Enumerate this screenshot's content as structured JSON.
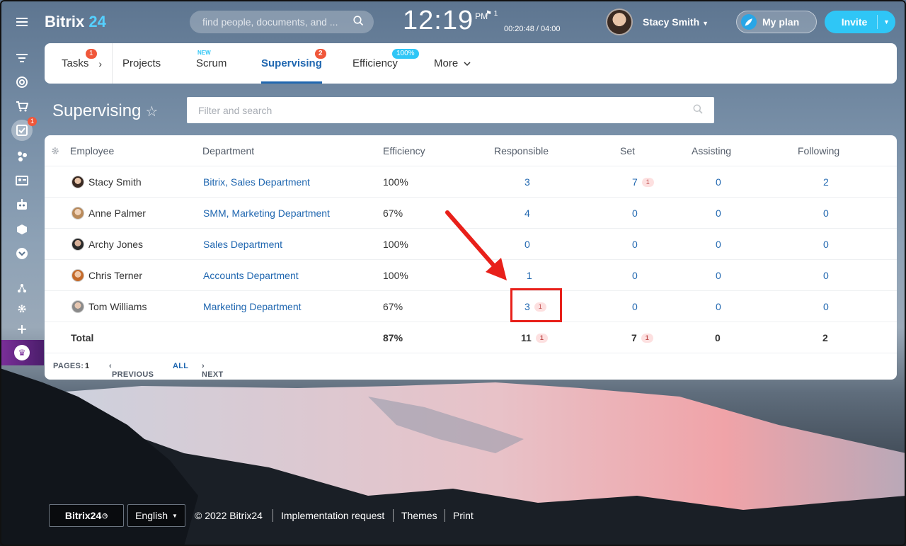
{
  "app": {
    "logo_name": "Bitrix",
    "logo_num": "24",
    "search_placeholder": "find people, documents, and ...",
    "clock_time": "12:19",
    "clock_ampm": "PM",
    "flag_count": "1",
    "timer": "00:20:48 / 04:00",
    "user_name": "Stacy Smith",
    "myplan_label": "My plan",
    "invite_label": "Invite"
  },
  "sidebar": {
    "active_badge": "1"
  },
  "tabs": [
    {
      "label": "Tasks",
      "badge": "1"
    },
    {
      "label": "Projects"
    },
    {
      "label": "Scrum",
      "tag": "NEW"
    },
    {
      "label": "Supervising",
      "badge": "2"
    },
    {
      "label": "Efficiency",
      "pct": "100%"
    },
    {
      "label": "More"
    }
  ],
  "page": {
    "title": "Supervising",
    "filter_placeholder": "Filter and search"
  },
  "grid": {
    "columns": [
      "Employee",
      "Department",
      "Efficiency",
      "Responsible",
      "Set",
      "Assisting",
      "Following"
    ],
    "rows": [
      {
        "employee": "Stacy Smith",
        "department": "Bitrix, Sales Department",
        "efficiency": "100%",
        "responsible": "3",
        "set": "7",
        "set_counter": "1",
        "assisting": "0",
        "following": "2"
      },
      {
        "employee": "Anne Palmer",
        "department": "SMM, Marketing Department",
        "efficiency": "67%",
        "responsible": "4",
        "set": "0",
        "assisting": "0",
        "following": "0"
      },
      {
        "employee": "Archy Jones",
        "department": "Sales Department",
        "efficiency": "100%",
        "responsible": "0",
        "set": "0",
        "assisting": "0",
        "following": "0"
      },
      {
        "employee": "Chris Terner",
        "department": "Accounts Department",
        "efficiency": "100%",
        "responsible": "1",
        "set": "0",
        "assisting": "0",
        "following": "0"
      },
      {
        "employee": "Tom Williams",
        "department": "Marketing Department",
        "efficiency": "67%",
        "responsible": "3",
        "responsible_counter": "1",
        "set": "0",
        "assisting": "0",
        "following": "0"
      }
    ],
    "total": {
      "label": "Total",
      "efficiency": "87%",
      "responsible": "11",
      "responsible_counter": "1",
      "set": "7",
      "set_counter": "1",
      "assisting": "0",
      "following": "2"
    },
    "pager": {
      "pages_label": "PAGES:",
      "page": "1",
      "previous": "PREVIOUS",
      "all": "ALL",
      "next": "NEXT"
    }
  },
  "footer": {
    "logo": "Bitrix24",
    "language": "English",
    "copyright": "© 2022 Bitrix24",
    "implementation": "Implementation request",
    "themes": "Themes",
    "print": "Print"
  },
  "colors": {
    "accent": "#2fc6f6",
    "link": "#2067b0",
    "badge": "#f0573a",
    "annotation": "#e8201a"
  }
}
